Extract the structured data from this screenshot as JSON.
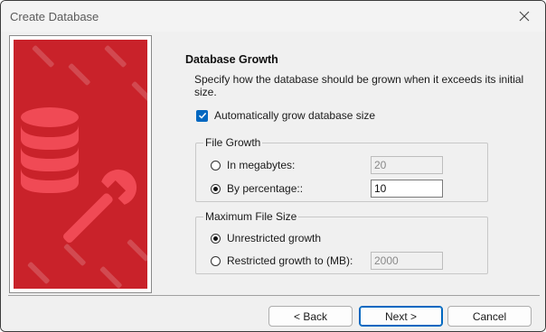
{
  "window": {
    "title": "Create Database"
  },
  "icons": {
    "close": "close-icon",
    "banner_database": "database-icon",
    "banner_wrench": "wrench-icon",
    "checkmark": "checkmark-icon"
  },
  "colors": {
    "banner_red": "#c9222a",
    "banner_icon": "#f04a55",
    "accent_blue": "#0067c0"
  },
  "page": {
    "heading": "Database Growth",
    "description": "Specify how the database should be grown when it exceeds its initial size.",
    "auto_grow": {
      "label": "Automatically grow database size",
      "checked": true
    }
  },
  "file_growth": {
    "legend": "File Growth",
    "megabytes_label": "In megabytes:",
    "megabytes_value": "20",
    "percentage_label": "By percentage::",
    "percentage_value": "10",
    "selected": "percentage"
  },
  "max_file_size": {
    "legend": "Maximum File Size",
    "unrestricted_label": "Unrestricted growth",
    "restricted_label": "Restricted growth to (MB):",
    "restricted_value": "2000",
    "selected": "unrestricted"
  },
  "footer": {
    "back_label": "< Back",
    "next_label": "Next >",
    "cancel_label": "Cancel"
  }
}
